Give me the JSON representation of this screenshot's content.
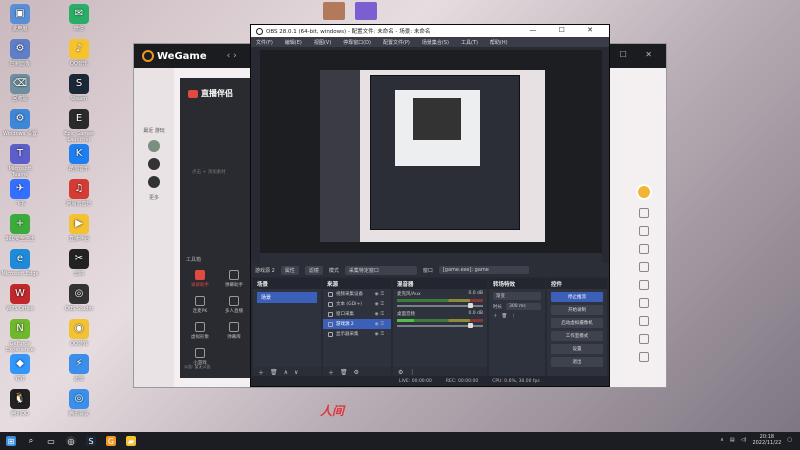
{
  "desktop": {
    "icons": [
      {
        "label": "此电脑",
        "color": "#5a8fd6",
        "glyph": "▣"
      },
      {
        "label": "控制面板",
        "color": "#5e7fc8",
        "glyph": "⚙"
      },
      {
        "label": "回收站",
        "color": "#6f8fa0",
        "glyph": "⌫"
      },
      {
        "label": "Windows 设置",
        "color": "#3e86d8",
        "glyph": "⚙"
      },
      {
        "label": "Microsoft Teams",
        "color": "#5b5fc7",
        "glyph": "T"
      },
      {
        "label": "飞书",
        "color": "#3370ff",
        "glyph": "✈"
      },
      {
        "label": "360安全卫士",
        "color": "#3caa3c",
        "glyph": "+"
      },
      {
        "label": "Microsoft Edge",
        "color": "#1d8bd8",
        "glyph": "e"
      },
      {
        "label": "WPS Office",
        "color": "#c0282c",
        "glyph": "W"
      },
      {
        "label": "GeForce Experience",
        "color": "#6fb82e",
        "glyph": "N"
      },
      {
        "label": "钉钉",
        "color": "#3296fa",
        "glyph": "◆"
      },
      {
        "label": "腾讯QQ",
        "color": "#222",
        "glyph": "🐧"
      },
      {
        "label": "微信",
        "color": "#2aae67",
        "glyph": "✉"
      },
      {
        "label": "QQ音乐",
        "color": "#f6c22e",
        "glyph": "♪"
      },
      {
        "label": "Steam",
        "color": "#1b2838",
        "glyph": "S"
      },
      {
        "label": "Epic Games Launcher",
        "color": "#2a2a2a",
        "glyph": "E"
      },
      {
        "label": "酷狗音乐",
        "color": "#1f7ff0",
        "glyph": "K"
      },
      {
        "label": "网易云音乐",
        "color": "#d43c33",
        "glyph": "♫"
      },
      {
        "label": "直播伴侣",
        "color": "#f2c233",
        "glyph": "▶"
      },
      {
        "label": "剪映",
        "color": "#222",
        "glyph": "✂"
      },
      {
        "label": "OBS Studio",
        "color": "#333",
        "glyph": "◎"
      },
      {
        "label": "QQ游戏",
        "color": "#f2c233",
        "glyph": "◉"
      },
      {
        "label": "迅雷",
        "color": "#3b8fea",
        "glyph": "⚡"
      },
      {
        "label": "腾讯会议",
        "color": "#3b8fea",
        "glyph": "◎"
      }
    ]
  },
  "wegame": {
    "logo": "WeGame",
    "nav": "‹  ›",
    "left_label": "最近 游玩",
    "more": "更多",
    "live": {
      "title": "直播伴侣",
      "hint": "点击 + 添加素材",
      "tools_label": "工具箱",
      "tools": [
        "录屏助手",
        "弹幕助手",
        "连麦PK",
        "多人直播",
        "虚拟形象",
        "弹幕库",
        "小游戏"
      ],
      "footer": "公告: 暂无公告"
    },
    "anime_text": "人间"
  },
  "obs": {
    "title": "OBS 28.0.1 (64-bit, windows) - 配置文件: 未命名 - 场景: 未命名",
    "menu": [
      "文件(F)",
      "编辑(E)",
      "视图(V)",
      "停靠窗口(D)",
      "配置文件(P)",
      "场景集合(S)",
      "工具(T)",
      "帮助(H)"
    ],
    "props_bar": {
      "source": "游戏源 2",
      "properties": "属性",
      "filters": "滤镜",
      "mode_label": "模式",
      "mode_value": "采集特定窗口",
      "window_label": "窗口",
      "window_value": "[game.exe]: game"
    },
    "scenes": {
      "title": "场景",
      "items": [
        "场景"
      ]
    },
    "sources": {
      "title": "来源",
      "items": [
        "视频采集设备",
        "文本 (GDI+)",
        "窗口采集",
        "游戏源 2",
        "显示器采集"
      ]
    },
    "mixer": {
      "title": "混音器",
      "channels": [
        {
          "name": "麦克风/Aux",
          "db": "0.0 dB"
        },
        {
          "name": "桌面音频",
          "db": "0.0 dB"
        }
      ]
    },
    "transitions": {
      "title": "转场特效",
      "type": "渐变",
      "duration_label": "时长",
      "duration": "300 ms"
    },
    "controls": {
      "title": "控件",
      "buttons": [
        "停止推流",
        "开始录制",
        "启动虚拟摄像机",
        "工作室模式",
        "设置",
        "退出"
      ]
    },
    "status": {
      "live": "LIVE: 00:00:00",
      "rec": "REC: 00:00:00",
      "cpu": "CPU: 0.6%, 30.00 fps"
    }
  },
  "taskbar": {
    "time": "20:18",
    "date": "2022/11/22"
  }
}
